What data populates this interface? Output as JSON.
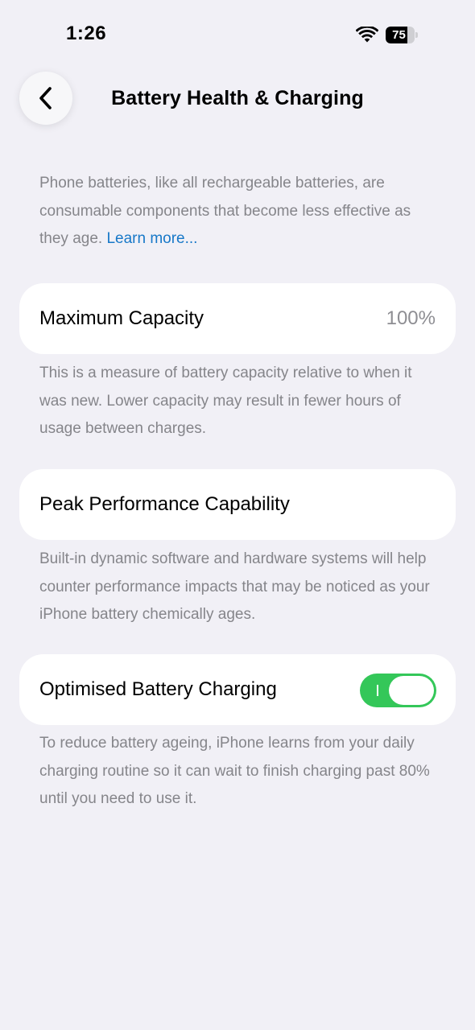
{
  "status_bar": {
    "time": "1:26",
    "battery_level": "75",
    "battery_fraction": 0.75
  },
  "header": {
    "title": "Battery Health & Charging",
    "back_icon": "chevron-left-icon"
  },
  "intro": {
    "text": "Phone batteries, like all rechargeable batteries, are consumable components that become less effective as they age. ",
    "link": "Learn more..."
  },
  "max_capacity": {
    "label": "Maximum Capacity",
    "value": "100%",
    "footnote": "This is a measure of battery capacity relative to when it was new. Lower capacity may result in fewer hours of usage between charges."
  },
  "peak_performance": {
    "label": "Peak Performance Capability",
    "footnote": "Built-in dynamic software and hardware systems will help counter performance impacts that may be noticed as your iPhone battery chemically ages."
  },
  "optimised_charging": {
    "label": "Optimised Battery Charging",
    "enabled": true,
    "footnote": "To reduce battery ageing, iPhone learns from your daily charging routine so it can wait to finish charging past 80% until you need to use it."
  },
  "colors": {
    "background": "#f1f0f6",
    "accent_link": "#1778c8",
    "toggle_on": "#34c759",
    "secondary_text": "#85858a"
  }
}
